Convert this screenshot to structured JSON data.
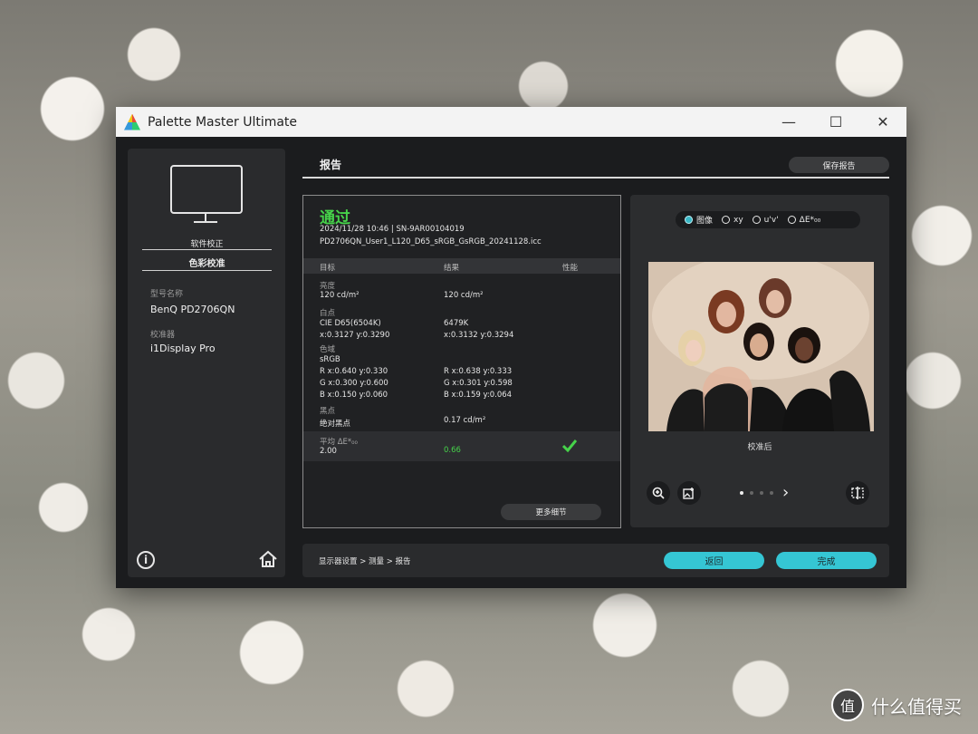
{
  "window": {
    "title": "Palette Master Ultimate",
    "controls": [
      "—",
      "☐",
      "✕"
    ]
  },
  "sidebar": {
    "step1": "软件校正",
    "step2": "色彩校准",
    "model_label": "型号名称",
    "model_value": "BenQ PD2706QN",
    "device_label": "校准器",
    "device_value": "i1Display Pro",
    "info_icon": "i"
  },
  "header": {
    "title": "报告",
    "save_label": "保存报告"
  },
  "report": {
    "status": "通过",
    "timestamp_serial": "2024/11/28 10:46 | SN-9AR00104019",
    "profile": "PD2706QN_User1_L120_D65_sRGB_GsRGB_20241128.icc",
    "columns": [
      "目标",
      "结果",
      "性能"
    ],
    "rows": [
      {
        "label": "亮度",
        "target": [
          "120 cd/m²"
        ],
        "result": [
          "120 cd/m²"
        ]
      },
      {
        "label": "白点",
        "target": [
          "CIE D65(6504K)",
          "x:0.3127 y:0.3290"
        ],
        "result": [
          "6479K",
          "x:0.3132 y:0.3294"
        ]
      },
      {
        "label": "色域",
        "target": [
          "sRGB",
          "R x:0.640 y:0.330",
          "G x:0.300 y:0.600",
          "B x:0.150 y:0.060"
        ],
        "result": [
          "",
          "R x:0.638 y:0.333",
          "G x:0.301 y:0.598",
          "B x:0.159 y:0.064"
        ]
      },
      {
        "label": "黑点",
        "target": [
          "绝对黑点"
        ],
        "result": [
          "0.17 cd/m²"
        ]
      }
    ],
    "average": {
      "label": "平均 ΔE*₀₀",
      "target": "2.00",
      "result": "0.66"
    },
    "more_label": "更多细节"
  },
  "preview": {
    "tabs": [
      "图像",
      "xy",
      "u'v'",
      "ΔE*₀₀"
    ],
    "caption": "校准后",
    "page_dots": 4,
    "active_dot": 0
  },
  "footer": {
    "breadcrumb": "显示器设置 >  测量 >  报告",
    "back_label": "返回",
    "done_label": "完成"
  },
  "watermark": {
    "text": "什么值得买",
    "logo": "值"
  },
  "colors": {
    "accent": "#35c6d4",
    "pass": "#46d24a"
  }
}
